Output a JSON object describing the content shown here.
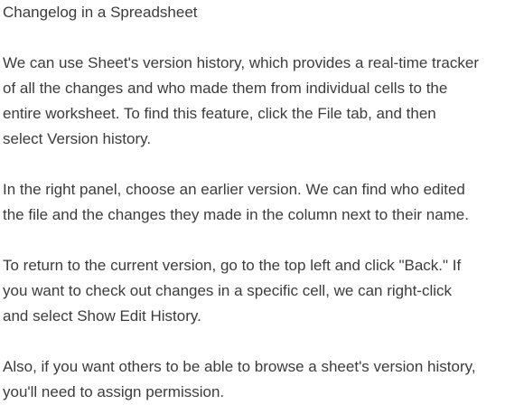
{
  "document": {
    "title": "Changelog in a Spreadsheet",
    "paragraphs": [
      {
        "lines": [
          "We can use Sheet's version history, which provides a real-time tracker",
          "of all the changes and who made them from individual cells to the",
          "entire worksheet. To find this feature, click the File tab, and then",
          "select Version history."
        ]
      },
      {
        "lines": [
          "In the right panel, choose an earlier version. We can find who edited",
          "the file and the changes they made in the column next to their name."
        ]
      },
      {
        "lines": [
          "To return to the current version, go to the top left and click \"Back.\" If",
          "you want to check out changes in a specific cell, we can right-click",
          "and select Show Edit History."
        ]
      },
      {
        "lines": [
          "Also, if you want others to be able to browse a sheet's version history,",
          "you'll need to assign permission."
        ]
      }
    ]
  }
}
